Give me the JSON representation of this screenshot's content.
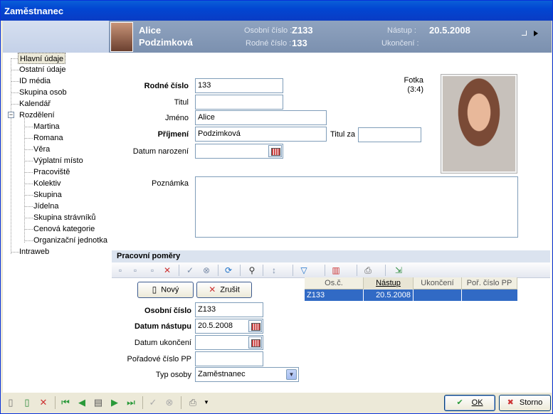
{
  "window": {
    "title": "Zaměstnanec"
  },
  "header": {
    "first_name": "Alice",
    "last_name": "Podzimková",
    "personal_number_label": "Osobní číslo :",
    "personal_number": "Z133",
    "birth_number_label": "Rodné číslo :",
    "birth_number": "133",
    "start_label": "Nástup :",
    "start_date": "20.5.2008",
    "end_label": "Ukončení :",
    "end_date": ""
  },
  "tree": {
    "items": [
      {
        "label": "Hlavní údaje"
      },
      {
        "label": "Ostatní údaje"
      },
      {
        "label": "ID média"
      },
      {
        "label": "Skupina osob"
      },
      {
        "label": "Kalendář"
      },
      {
        "label": "Rozdělení"
      },
      {
        "label": "Martina"
      },
      {
        "label": "Romana"
      },
      {
        "label": "Věra"
      },
      {
        "label": "Výplatní místo"
      },
      {
        "label": "Pracoviště"
      },
      {
        "label": "Kolektiv"
      },
      {
        "label": "Skupina"
      },
      {
        "label": "Jídelna"
      },
      {
        "label": "Skupina strávníků"
      },
      {
        "label": "Cenová kategorie"
      },
      {
        "label": "Organizační jednotka"
      },
      {
        "label": "Intraweb"
      }
    ],
    "toggle_symbol": "−"
  },
  "form": {
    "birth_number_label": "Rodné číslo",
    "birth_number_value": "133",
    "title_label": "Titul",
    "title_value": "",
    "first_name_label": "Jméno",
    "first_name_value": "Alice",
    "last_name_label": "Příjmení",
    "last_name_value": "Podzimková",
    "title_after_label": "Titul za",
    "title_after_value": "",
    "birth_date_label": "Datum narození",
    "birth_date_value": "",
    "note_label": "Poznámka",
    "note_value": "",
    "photo_label": "Fotka",
    "photo_ratio": "(3:4)"
  },
  "employment": {
    "section_title": "Pracovní poměry",
    "new_button": "Nový",
    "cancel_button": "Zrušit",
    "personal_number_label": "Osobní číslo",
    "personal_number_value": "Z133",
    "start_date_label": "Datum nástupu",
    "start_date_value": "20.5.2008",
    "end_date_label": "Datum ukončení",
    "end_date_value": "",
    "order_label": "Pořadové číslo PP",
    "order_value": "",
    "person_type_label": "Typ osoby",
    "person_type_value": "Zaměstnanec",
    "grid": {
      "columns": [
        "Os.č.",
        "Nástup",
        "Ukončení",
        "Poř. číslo PP"
      ],
      "rows": [
        [
          "Z133",
          "20.5.2008",
          "",
          ""
        ]
      ]
    }
  },
  "footer": {
    "ok_label": "OK",
    "cancel_label": "Storno"
  },
  "colors": {
    "titlebar": "#0246d2",
    "header": "#7b90af",
    "selection": "#316ac5"
  }
}
